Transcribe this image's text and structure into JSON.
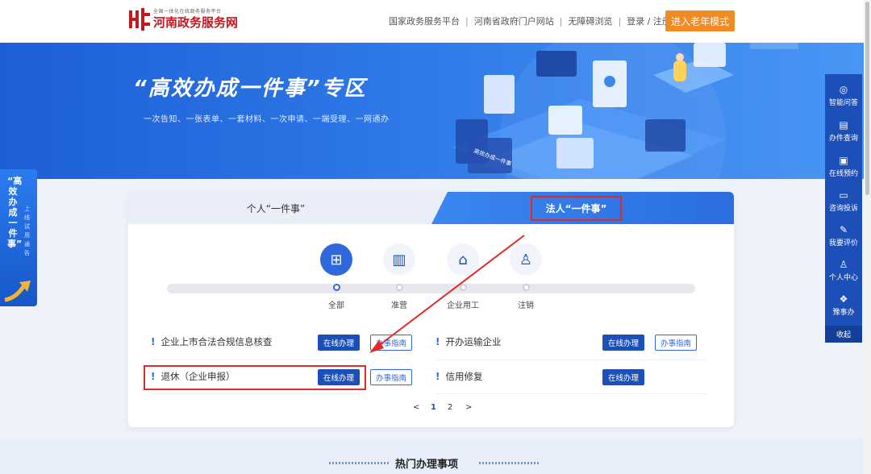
{
  "header": {
    "logo_sub": "全国一体化在线政务服务平台",
    "logo_main": "河南政务服务网",
    "nav": [
      "国家政务服务平台",
      "河南省政府门户网站",
      "无障碍浏览"
    ],
    "login_register": "登录 / 注册",
    "elder_mode": "进入老年模式"
  },
  "banner": {
    "title": "“高效办成一件事”专区",
    "subtitle": "一次告知、一张表单、一套材料、一次申请、一端受理、一网通办",
    "screen_text": "高效办成一件事"
  },
  "left_float": {
    "big_text": "“高效办成一件事”",
    "small_text": "上线试用通告"
  },
  "sidebar": {
    "items": [
      {
        "label": "智能问答",
        "icon": "chat-bot-icon"
      },
      {
        "label": "办件查询",
        "icon": "document-search-icon"
      },
      {
        "label": "在线预约",
        "icon": "calendar-icon"
      },
      {
        "label": "咨询投诉",
        "icon": "message-icon"
      },
      {
        "label": "我要评价",
        "icon": "edit-icon"
      },
      {
        "label": "个人中心",
        "icon": "user-icon"
      },
      {
        "label": "豫事办",
        "icon": "app-icon"
      }
    ],
    "collapse": "收起"
  },
  "tabs": {
    "personal": "个人“一件事”",
    "legal": "法人“一件事”"
  },
  "categories": [
    {
      "label": "全部",
      "icon": "grid-icon",
      "active": true
    },
    {
      "label": "准营",
      "icon": "building-icon",
      "active": false
    },
    {
      "label": "企业用工",
      "icon": "seal-icon",
      "active": false
    },
    {
      "label": "注销",
      "icon": "person-icon",
      "active": false
    }
  ],
  "services": [
    {
      "name": "企业上市合法合规信息核查",
      "online": "在线办理",
      "guide": "办事指南"
    },
    {
      "name": "开办运输企业",
      "online": "在线办理",
      "guide": "办事指南"
    },
    {
      "name": "退休（企业申报）",
      "online": "在线办理",
      "guide": "办事指南"
    },
    {
      "name": "信用修复",
      "online": "在线办理"
    }
  ],
  "pagination": {
    "prev": "<",
    "pages": [
      "1",
      "2"
    ],
    "current": "1",
    "next": ">"
  },
  "hot": {
    "title": "热门办理事项"
  },
  "colors": {
    "primary": "#1d4fb8",
    "accent_orange": "#f08a24",
    "highlight_red": "#e12b22",
    "logo_red": "#c8161d"
  }
}
